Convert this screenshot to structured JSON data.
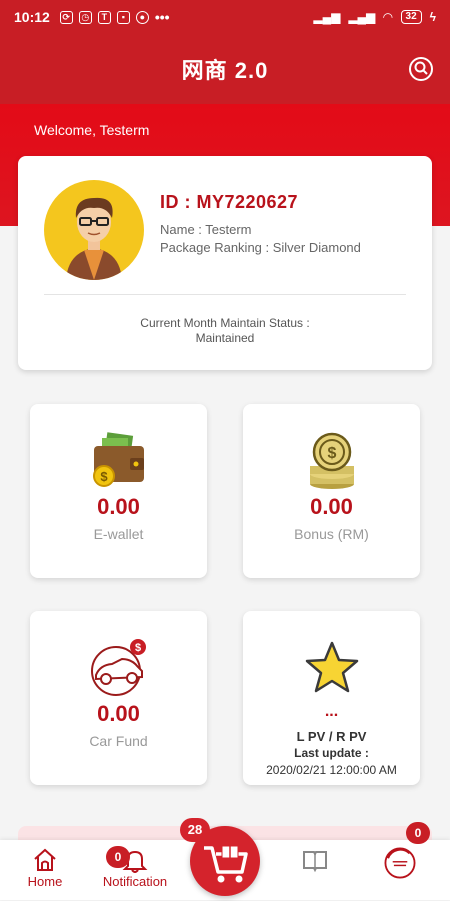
{
  "status_bar": {
    "time": "10:12",
    "battery": "32"
  },
  "app": {
    "title": "网商 2.0",
    "welcome": "Welcome, Testerm"
  },
  "profile": {
    "id": "ID : MY7220627",
    "name": "Name : Testerm",
    "ranking": "Package Ranking : Silver Diamond",
    "maintain_label": "Current Month Maintain Status :",
    "maintain_value": "Maintained"
  },
  "tiles": {
    "ewallet": {
      "amount": "0.00",
      "label": "E-wallet"
    },
    "bonus": {
      "amount": "0.00",
      "label": "Bonus (RM)"
    },
    "carfund": {
      "amount": "0.00",
      "label": "Car Fund"
    },
    "pv": {
      "value": "...",
      "label": "L PV / R PV",
      "update_label": "Last update :",
      "update_date": "2020/02/21 12:00:00 AM"
    }
  },
  "bottom_nav": {
    "home": "Home",
    "notification": "Notification",
    "notification_count": "0",
    "cart_count": "28",
    "right_badge": "0"
  },
  "colors": {
    "primary": "#c81e25",
    "accent_text": "#b8121b",
    "band": "#e30b17"
  },
  "icons": [
    "search-icon",
    "wallet-icon",
    "coins-icon",
    "car-icon",
    "star-icon",
    "home-icon",
    "bell-icon",
    "cart-icon",
    "book-icon",
    "coming-soon-icon"
  ]
}
